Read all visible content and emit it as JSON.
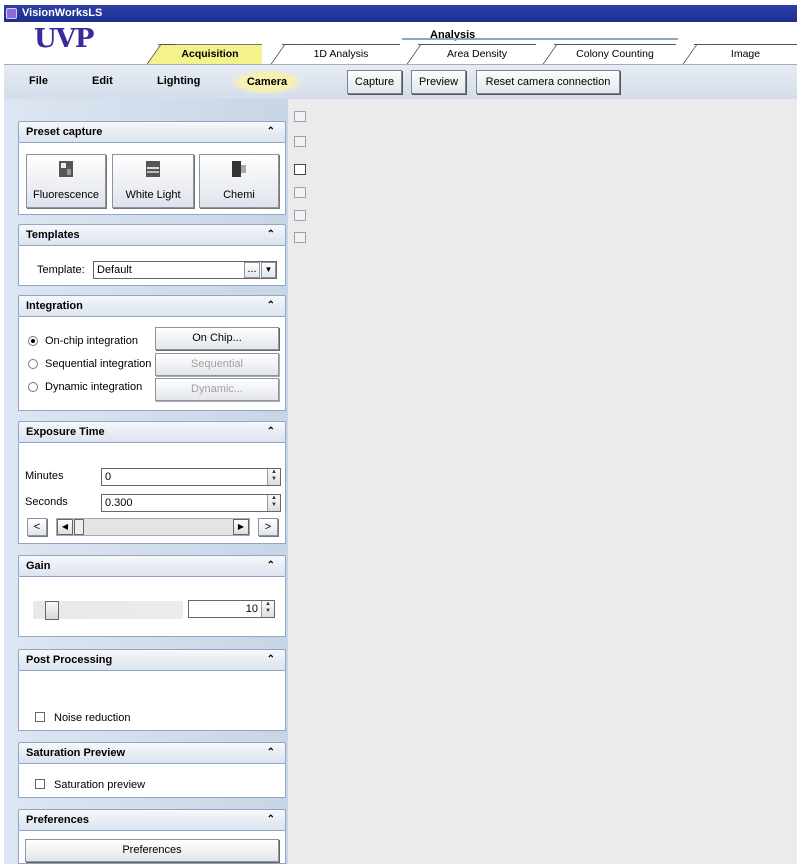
{
  "window": {
    "title": "VisionWorksLS"
  },
  "header": {
    "logo": "UVP",
    "analysis_label": "Analysis"
  },
  "tabs": [
    {
      "label": "Acquisition",
      "active": true
    },
    {
      "label": "1D Analysis"
    },
    {
      "label": "Area Density"
    },
    {
      "label": "Colony Counting"
    },
    {
      "label": "Image"
    }
  ],
  "menu": {
    "file": "File",
    "edit": "Edit",
    "lighting": "Lighting",
    "camera": "Camera"
  },
  "toolbar": {
    "capture": "Capture",
    "preview": "Preview",
    "reset": "Reset camera connection"
  },
  "panels": {
    "preset": {
      "title": "Preset capture",
      "buttons": [
        "Fluorescence",
        "White Light",
        "Chemi"
      ]
    },
    "templates": {
      "title": "Templates",
      "label": "Template:",
      "value": "Default",
      "browse": "..."
    },
    "integration": {
      "title": "Integration",
      "options": [
        {
          "label": "On-chip integration",
          "button": "On Chip...",
          "selected": true,
          "enabled": true
        },
        {
          "label": "Sequential integration",
          "button": "Sequential",
          "selected": false,
          "enabled": false
        },
        {
          "label": "Dynamic integration",
          "button": "Dynamic...",
          "selected": false,
          "enabled": false
        }
      ]
    },
    "exposure": {
      "title": "Exposure Time",
      "minutes_label": "Minutes",
      "minutes": "0",
      "seconds_label": "Seconds",
      "seconds": "0.300",
      "prev": "<",
      "next": ">"
    },
    "gain": {
      "title": "Gain",
      "value": "10"
    },
    "post": {
      "title": "Post Processing",
      "noise": "Noise reduction"
    },
    "saturation": {
      "title": "Saturation Preview",
      "checkbox": "Saturation preview"
    },
    "preferences": {
      "title": "Preferences",
      "button": "Preferences"
    }
  },
  "colors": {
    "title_bar": "#2c3fa8",
    "active_tab": "#f4f28a",
    "panel_border": "#8fa6c4"
  }
}
